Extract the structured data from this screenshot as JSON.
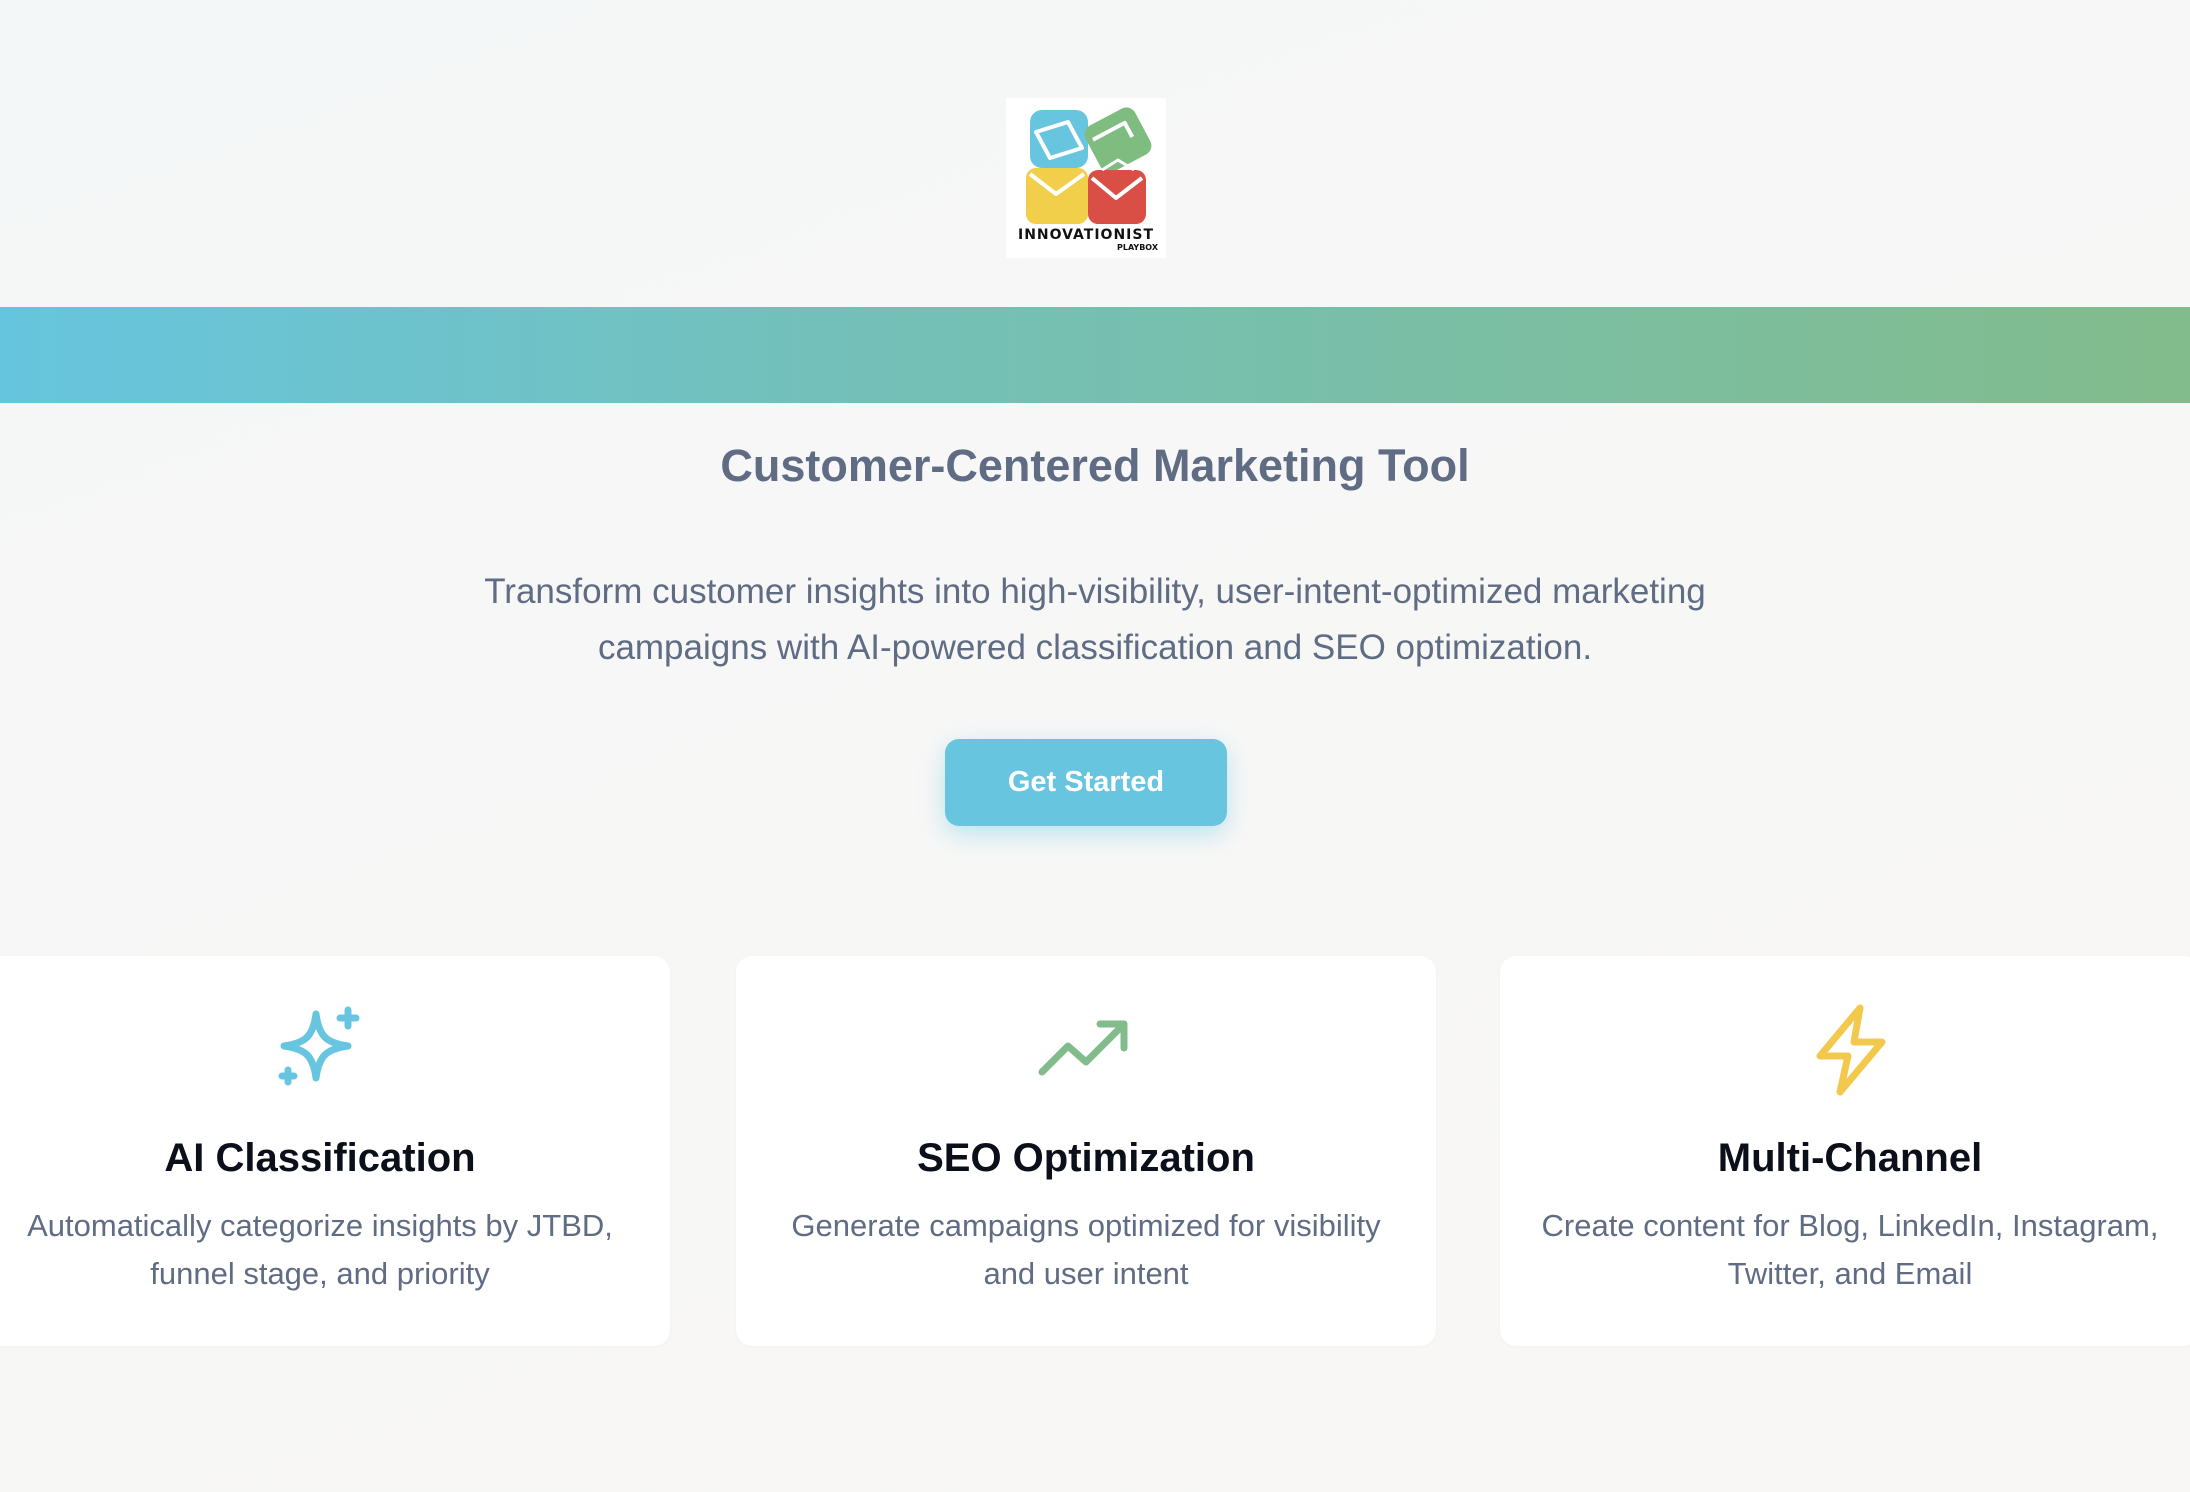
{
  "logo": {
    "name": "INNOVATIONIST",
    "sub": "PLAYBOX",
    "icon": "playbox-logo-icon"
  },
  "hero": {
    "subtitle": "Customer-Centered Marketing Tool",
    "description": "Transform customer insights into high-visibility, user-intent-optimized marketing campaigns with AI-powered classification and SEO optimization.",
    "cta_label": "Get Started"
  },
  "colors": {
    "accent_blue": "#67c5e0",
    "accent_green": "#82bc8c",
    "accent_yellow": "#f2c94c",
    "text_muted": "#5f6c83"
  },
  "features": [
    {
      "icon": "sparkles-icon",
      "title": "AI Classification",
      "description": "Automatically categorize insights by JTBD, funnel stage, and priority"
    },
    {
      "icon": "trending-up-icon",
      "title": "SEO Optimization",
      "description": "Generate campaigns optimized for visibility and user intent"
    },
    {
      "icon": "lightning-icon",
      "title": "Multi-Channel",
      "description": "Create content for Blog, LinkedIn, Instagram, Twitter, and Email"
    }
  ]
}
